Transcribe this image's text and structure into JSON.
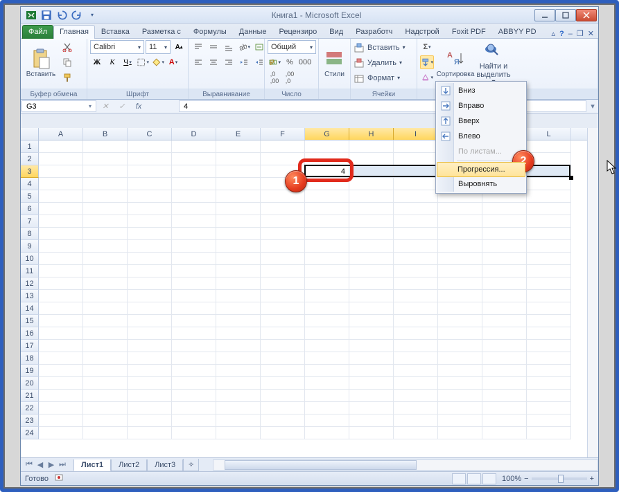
{
  "window": {
    "title": "Книга1 - Microsoft Excel"
  },
  "qat": {
    "save": "save-icon",
    "undo": "undo-icon",
    "redo": "redo-icon"
  },
  "tabs": {
    "file": "Файл",
    "items": [
      "Главная",
      "Вставка",
      "Разметка с",
      "Формулы",
      "Данные",
      "Рецензиро",
      "Вид",
      "Разработч",
      "Надстрой",
      "Foxit PDF",
      "ABBYY PD"
    ],
    "active": 0
  },
  "ribbon": {
    "clipboard": {
      "paste": "Вставить",
      "label": "Буфер обмена"
    },
    "font": {
      "name": "Calibri",
      "size": "11",
      "label": "Шрифт"
    },
    "alignment": {
      "label": "Выравнивание"
    },
    "number": {
      "format": "Общий",
      "label": "Число"
    },
    "styles": {
      "btn": "Стили",
      "label": ""
    },
    "cells": {
      "insert": "Вставить",
      "delete": "Удалить",
      "format": "Формат",
      "label": "Ячейки"
    },
    "editing": {
      "sort": "Сортировка",
      "find": "Найти и",
      "find2": "выделить",
      "label": ""
    }
  },
  "namebox": "G3",
  "formula": "4",
  "columns": [
    "A",
    "B",
    "C",
    "D",
    "E",
    "F",
    "G",
    "H",
    "I",
    "J",
    "K",
    "L"
  ],
  "rows_count": 24,
  "selection": {
    "active_cell": "G3",
    "active_value": "4",
    "range_start_col": 6,
    "range_end_col": 11,
    "row": 2,
    "highlighted_cols": [
      6,
      7,
      8
    ]
  },
  "fill_menu": {
    "items": [
      {
        "label": "Вниз",
        "icon": "arrow-down-box"
      },
      {
        "label": "Вправо",
        "icon": "arrow-right-box"
      },
      {
        "label": "Вверх",
        "icon": "arrow-up-box"
      },
      {
        "label": "Влево",
        "icon": "arrow-left-box"
      },
      {
        "label": "По листам...",
        "disabled": true
      },
      {
        "label": "Прогрессия...",
        "hover": true
      },
      {
        "label": "Выровнять"
      }
    ]
  },
  "sheets": {
    "items": [
      "Лист1",
      "Лист2",
      "Лист3"
    ],
    "active": 0
  },
  "status": {
    "ready": "Готово",
    "zoom": "100%"
  },
  "badges": {
    "one": "1",
    "two": "2"
  }
}
